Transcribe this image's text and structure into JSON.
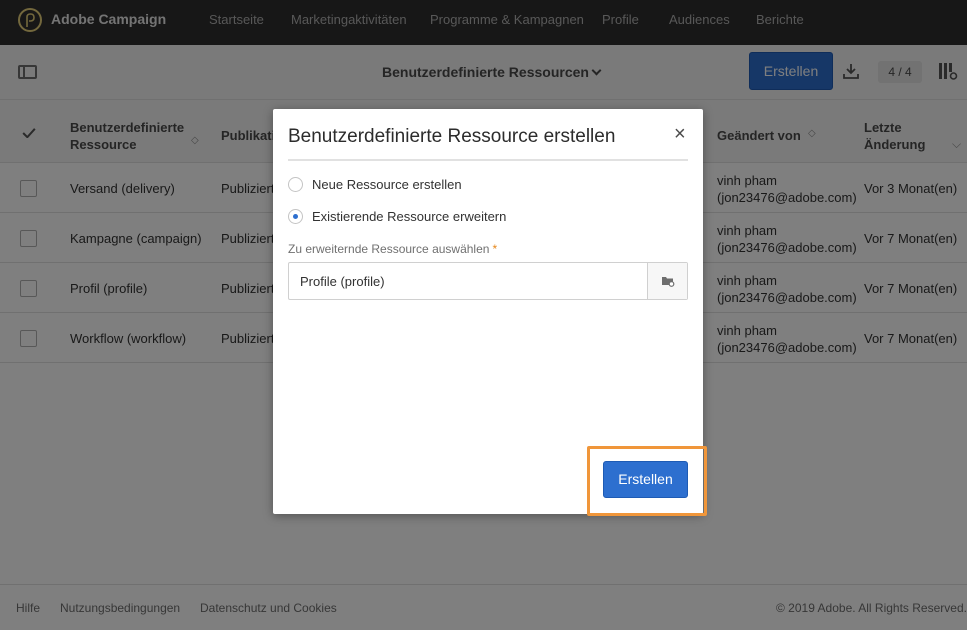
{
  "app": {
    "title": "Adobe Campaign"
  },
  "nav": {
    "items": [
      "Startseite",
      "Marketingaktivitäten",
      "Programme & Kampagnen",
      "Profile",
      "Audiences",
      "Berichte"
    ]
  },
  "toolbar": {
    "view_title": "Benutzerdefinierte Ressourcen",
    "create_label": "Erstellen",
    "counter": "4 / 4"
  },
  "table": {
    "headers": {
      "resource": "Benutzerdefinierte Ressource",
      "publication": "Publikati",
      "modified_by": "Geändert von",
      "last_change": "Letzte Änderung"
    },
    "rows": [
      {
        "resource": "Versand (delivery)",
        "publication": "Publiziert",
        "modified_by_name": "vinh pham",
        "modified_by_email": "(jon23476@adobe.com)",
        "last_change": "Vor 3 Monat(en)"
      },
      {
        "resource": "Kampagne (campaign)",
        "publication": "Publiziert",
        "modified_by_name": "vinh pham",
        "modified_by_email": "(jon23476@adobe.com)",
        "last_change": "Vor 7 Monat(en)"
      },
      {
        "resource": "Profil (profile)",
        "publication": "Publiziert",
        "modified_by_name": "vinh pham",
        "modified_by_email": "(jon23476@adobe.com)",
        "last_change": "Vor 7 Monat(en)"
      },
      {
        "resource": "Workflow (workflow)",
        "publication": "Publiziert",
        "modified_by_name": "vinh pham",
        "modified_by_email": "(jon23476@adobe.com)",
        "last_change": "Vor 7 Monat(en)"
      }
    ]
  },
  "footer": {
    "help": "Hilfe",
    "terms": "Nutzungsbedingungen",
    "privacy": "Datenschutz und Cookies",
    "copyright": "© 2019 Adobe. All Rights Reserved."
  },
  "dialog": {
    "title": "Benutzerdefinierte Ressource erstellen",
    "close": "×",
    "option_new": "Neue Ressource erstellen",
    "option_extend": "Existierende Ressource erweitern",
    "selected_option": "extend",
    "field_label": "Zu erweiternde Ressource auswählen",
    "required_mark": "*",
    "field_value": "Profile (profile)",
    "create_label": "Erstellen"
  },
  "colors": {
    "accent": "#2d6fcf",
    "highlight": "#f0963a",
    "nav_bg": "#2f2f2f"
  }
}
